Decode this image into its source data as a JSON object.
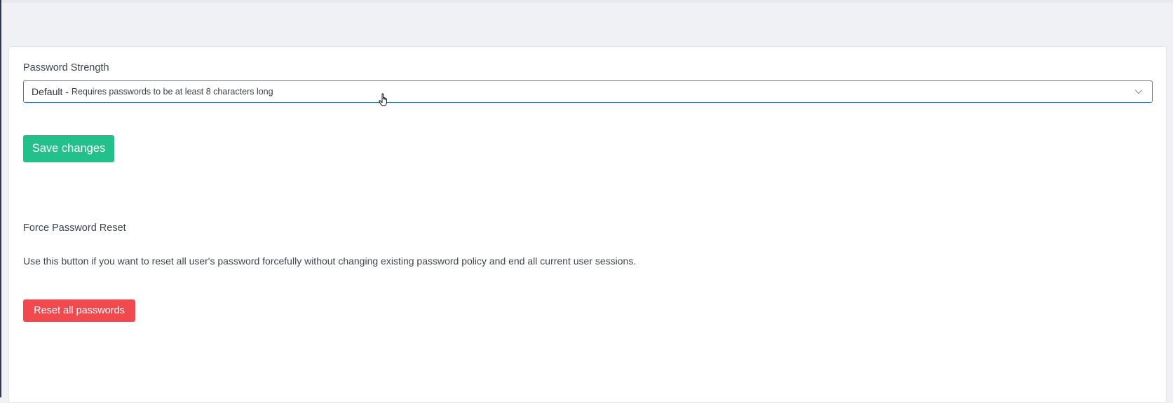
{
  "password_strength": {
    "label": "Password Strength",
    "selected_option": "Default -",
    "selected_description": "Requires passwords to be at least 8 characters long",
    "icon": "chevron-down-icon"
  },
  "save_button": {
    "label": "Save changes",
    "color": "#22c08a"
  },
  "force_reset": {
    "title": "Force Password Reset",
    "description": "Use this button if you want to reset all user's password forcefully without changing existing password policy and end all current user sessions.",
    "button_label": "Reset all passwords",
    "button_color": "#f2494e"
  },
  "theme": {
    "accent": "#3a7bd5",
    "background": "#eff1f5"
  }
}
